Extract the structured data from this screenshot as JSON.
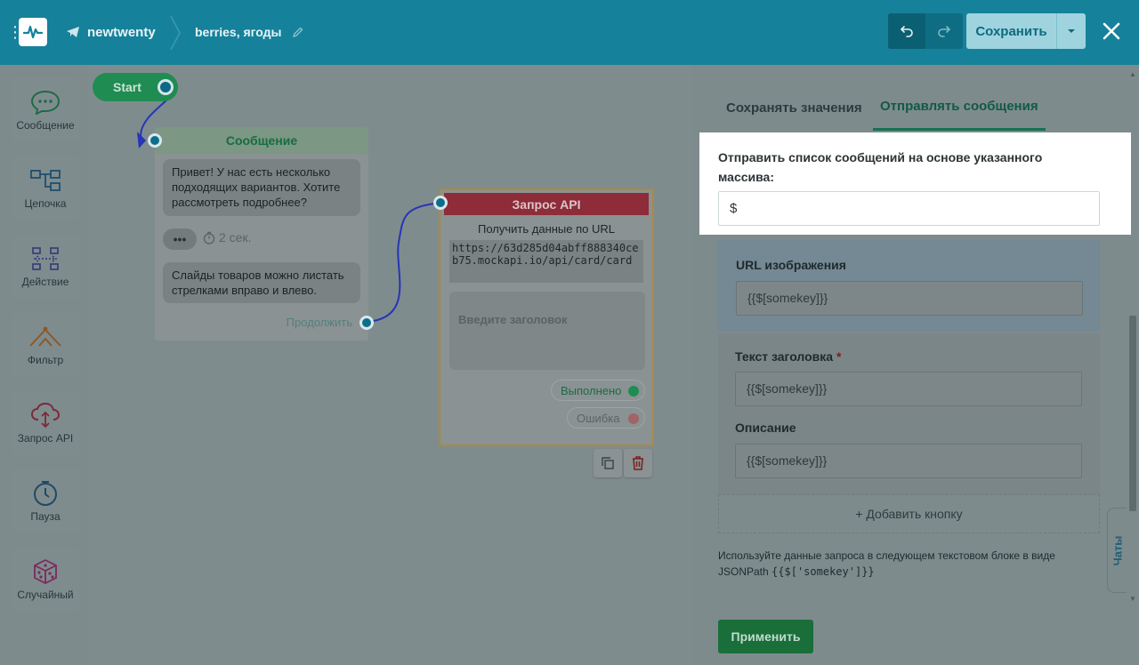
{
  "topbar": {
    "bot_name": "newtwenty",
    "flow_name": "berries, ягоды",
    "save_label": "Сохранить",
    "colors": {
      "bar": "#16819a",
      "save_bg": "#9fd4df"
    }
  },
  "sidebar": {
    "items": [
      {
        "label": "Сообщение",
        "icon": "chat-bubble-icon"
      },
      {
        "label": "Цепочка",
        "icon": "chain-icon"
      },
      {
        "label": "Действие",
        "icon": "action-icon"
      },
      {
        "label": "Фильтр",
        "icon": "filter-icon"
      },
      {
        "label": "Запрос API",
        "icon": "cloud-api-icon"
      },
      {
        "label": "Пауза",
        "icon": "clock-icon"
      },
      {
        "label": "Случайный",
        "icon": "dice-icon"
      }
    ]
  },
  "canvas": {
    "start_label": "Start",
    "message_node": {
      "title": "Сообщение",
      "bubble1": "Привет! У нас есть несколько подходящих вариантов. Хотите рассмотреть подробнее?",
      "typing": "•••",
      "delay": "2 сек.",
      "bubble2": "Слайды товаров можно листать стрелками вправо и влево.",
      "continue": "Продолжить"
    },
    "api_node": {
      "title": "Запрос API",
      "subtitle": "Получить данные по URL",
      "url": "https://63d285d04abff888340ceb75.mockapi.io/api/card/card",
      "title_placeholder": "Введите заголовок",
      "success": "Выполнено",
      "error": "Ошибка"
    }
  },
  "panel": {
    "tabs": [
      "Сохранять значения",
      "Отправлять сообщения"
    ],
    "array_label": "Отправить список сообщений на основе указанного массива:",
    "array_value": "$",
    "image_url_label": "URL изображения",
    "image_url_value": "{{$[somekey]}}",
    "title_label": "Текст заголовка",
    "required_mark": "*",
    "title_value": "{{$[somekey]}}",
    "description_label": "Описание",
    "description_value": "{{$[somekey]}}",
    "add_button": "+ Добавить кнопку",
    "hint_text": "Используйте данные запроса в следующем текстовом блоке в виде JSONPath",
    "hint_code": "{{$['somekey']}}",
    "apply": "Применить",
    "chats_tab": "Чаты"
  }
}
